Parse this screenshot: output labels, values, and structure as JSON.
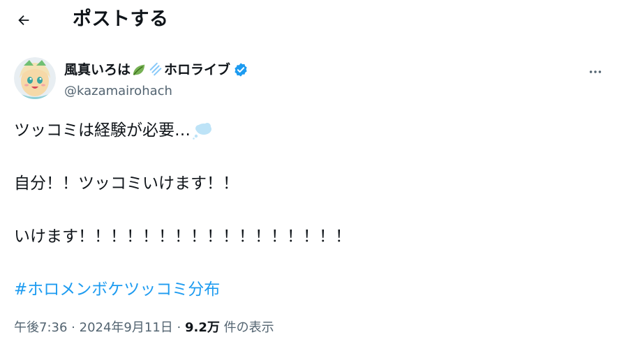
{
  "header": {
    "title": "ポストする",
    "back_icon": "arrow-left-icon"
  },
  "author": {
    "name_prefix": "風真いろは",
    "name_suffix": "ホロライブ",
    "handle": "@kazamairohach",
    "verified": true,
    "verified_color": "#1d9bf0"
  },
  "tweet": {
    "line1": "ツッコミは経験が必要…",
    "line2": "自分！！ツッコミいけます！！",
    "line3": "いけます！！！！！！！！！！！！！！！！！",
    "hashtag": "#ホロメンボケツッコミ分布"
  },
  "meta": {
    "time": "午後7:36",
    "date": "2024年9月11日",
    "separator": "·",
    "views_count": "9.2万",
    "views_label": "件の表示"
  },
  "colors": {
    "text": "#0f1419",
    "secondary": "#536471",
    "link": "#1d9bf0"
  }
}
